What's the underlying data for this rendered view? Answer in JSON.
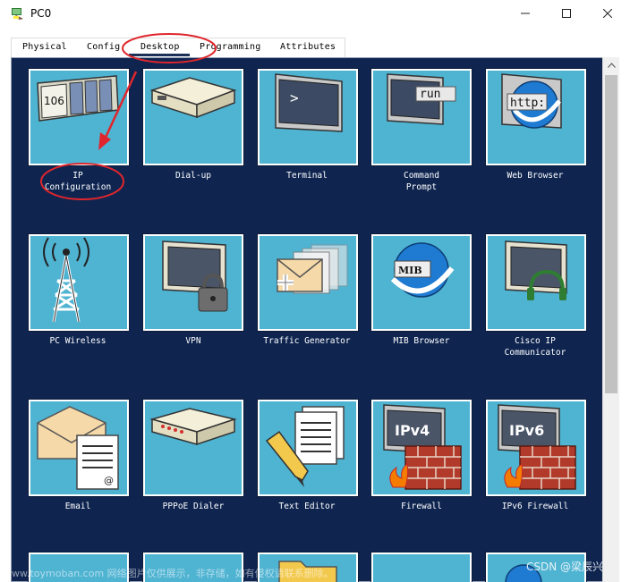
{
  "window": {
    "title": "PC0",
    "min_symbol": "—",
    "max_symbol": "☐",
    "close_symbol": "✕"
  },
  "tabs": [
    {
      "label": "Physical"
    },
    {
      "label": "Config"
    },
    {
      "label": "Desktop",
      "active": true
    },
    {
      "label": "Programming"
    },
    {
      "label": "Attributes"
    }
  ],
  "apps": [
    {
      "label": "IP\nConfiguration",
      "icon": "ip-configuration-icon",
      "highlighted": true
    },
    {
      "label": "Dial-up",
      "icon": "modem-icon"
    },
    {
      "label": "Terminal",
      "icon": "terminal-icon",
      "icon_text": ">"
    },
    {
      "label": "Command\nPrompt",
      "icon": "command-prompt-icon",
      "icon_text": "run"
    },
    {
      "label": "Web Browser",
      "icon": "web-browser-icon",
      "icon_text": "http:"
    },
    {
      "label": "PC Wireless",
      "icon": "wireless-tower-icon"
    },
    {
      "label": "VPN",
      "icon": "vpn-lock-icon"
    },
    {
      "label": "Traffic Generator",
      "icon": "traffic-generator-icon"
    },
    {
      "label": "MIB Browser",
      "icon": "mib-browser-icon",
      "icon_text": "MIB"
    },
    {
      "label": "Cisco IP\nCommunicator",
      "icon": "ip-communicator-icon"
    },
    {
      "label": "Email",
      "icon": "email-icon"
    },
    {
      "label": "PPPoE Dialer",
      "icon": "pppoe-dialer-icon"
    },
    {
      "label": "Text Editor",
      "icon": "text-editor-icon"
    },
    {
      "label": "Firewall",
      "icon": "firewall-icon",
      "icon_text": "IPv4"
    },
    {
      "label": "IPv6 Firewall",
      "icon": "ipv6-firewall-icon",
      "icon_text": "IPv6"
    }
  ],
  "ip_config_icon_text": "106",
  "watermark": "www.toymoban.com 网络图片仅供展示，非存储，如有侵权请联系删除。",
  "csdn_mark": "CSDN @梁辰兴",
  "colors": {
    "panel_bg": "#0f2550",
    "tile_bg": "#4fb3d2",
    "annotation_red": "#e0262c"
  }
}
